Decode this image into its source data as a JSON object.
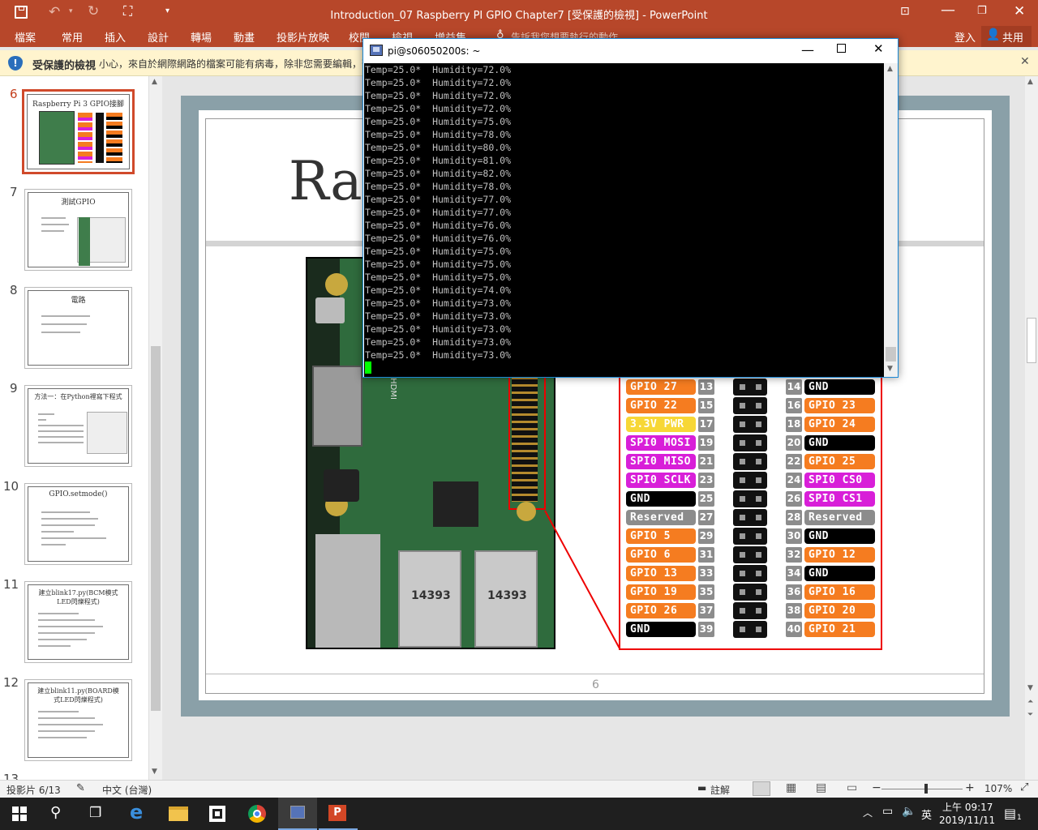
{
  "window": {
    "title": "Introduction_07 Raspberry PI GPIO Chapter7 [受保護的檢視] - PowerPoint"
  },
  "ribbon": {
    "tabs": [
      "檔案",
      "常用",
      "插入",
      "設計",
      "轉場",
      "動畫",
      "投影片放映",
      "校閱",
      "檢視",
      "增益集"
    ],
    "tell_me": "告訴我您想要執行的動作",
    "signin": "登入",
    "share": "共用"
  },
  "protected": {
    "label": "受保護的檢視",
    "message": "小心，來自於網際網路的檔案可能有病毒，除非您需要編輯，否則留在受保護的檢視中較為安全。"
  },
  "thumbnails": [
    {
      "num": "6",
      "title": "Raspberry Pi 3 GPIO接腳"
    },
    {
      "num": "7",
      "title": "測試GPIO"
    },
    {
      "num": "8",
      "title": "電路"
    },
    {
      "num": "9",
      "title": "方法一：在Python裡寫下程式"
    },
    {
      "num": "10",
      "title": "GPIO.setmode()"
    },
    {
      "num": "11",
      "title": "建立blink17.py(BCM模式LED閃爍程式)"
    },
    {
      "num": "12",
      "title": "建立blink11.py(BOARD模式LED閃爍程式)"
    },
    {
      "num": "13",
      "title": ""
    }
  ],
  "slide": {
    "title_partial": "Ras",
    "page_number": "6"
  },
  "pinout": {
    "left": [
      {
        "label": "GPIO 27",
        "num": "13",
        "color": "#f57c20"
      },
      {
        "label": "GPIO 22",
        "num": "15",
        "color": "#f57c20"
      },
      {
        "label": "3.3V PWR",
        "num": "17",
        "color": "#f7d736"
      },
      {
        "label": "SPI0 MOSI",
        "num": "19",
        "color": "#d81fd8"
      },
      {
        "label": "SPI0 MISO",
        "num": "21",
        "color": "#d81fd8"
      },
      {
        "label": "SPI0 SCLK",
        "num": "23",
        "color": "#d81fd8"
      },
      {
        "label": "GND",
        "num": "25",
        "color": "#000000"
      },
      {
        "label": "Reserved",
        "num": "27",
        "color": "#8c8c8c"
      },
      {
        "label": "GPIO 5",
        "num": "29",
        "color": "#f57c20"
      },
      {
        "label": "GPIO 6",
        "num": "31",
        "color": "#f57c20"
      },
      {
        "label": "GPIO 13",
        "num": "33",
        "color": "#f57c20"
      },
      {
        "label": "GPIO 19",
        "num": "35",
        "color": "#f57c20"
      },
      {
        "label": "GPIO 26",
        "num": "37",
        "color": "#f57c20"
      },
      {
        "label": "GND",
        "num": "39",
        "color": "#000000"
      }
    ],
    "right": [
      {
        "label": "GND",
        "num": "14",
        "color": "#000000"
      },
      {
        "label": "GPIO 23",
        "num": "16",
        "color": "#f57c20"
      },
      {
        "label": "GPIO 24",
        "num": "18",
        "color": "#f57c20"
      },
      {
        "label": "GND",
        "num": "20",
        "color": "#000000"
      },
      {
        "label": "GPIO 25",
        "num": "22",
        "color": "#f57c20"
      },
      {
        "label": "SPI0 CS0",
        "num": "24",
        "color": "#d81fd8"
      },
      {
        "label": "SPI0 CS1",
        "num": "26",
        "color": "#d81fd8"
      },
      {
        "label": "Reserved",
        "num": "28",
        "color": "#8c8c8c"
      },
      {
        "label": "GND",
        "num": "30",
        "color": "#000000"
      },
      {
        "label": "GPIO 12",
        "num": "32",
        "color": "#f57c20"
      },
      {
        "label": "GND",
        "num": "34",
        "color": "#000000"
      },
      {
        "label": "GPIO 16",
        "num": "36",
        "color": "#f57c20"
      },
      {
        "label": "GPIO 20",
        "num": "38",
        "color": "#f57c20"
      },
      {
        "label": "GPIO 21",
        "num": "40",
        "color": "#f57c20"
      }
    ]
  },
  "board": {
    "chip1": "14393",
    "chip2": "14393",
    "hdmi": "HDMI"
  },
  "putty": {
    "title": "pi@s06050200s: ~",
    "lines": [
      "Temp=25.0*  Humidity=72.0%",
      "Temp=25.0*  Humidity=72.0%",
      "Temp=25.0*  Humidity=72.0%",
      "Temp=25.0*  Humidity=72.0%",
      "Temp=25.0*  Humidity=75.0%",
      "Temp=25.0*  Humidity=78.0%",
      "Temp=25.0*  Humidity=80.0%",
      "Temp=25.0*  Humidity=81.0%",
      "Temp=25.0*  Humidity=82.0%",
      "Temp=25.0*  Humidity=78.0%",
      "Temp=25.0*  Humidity=77.0%",
      "Temp=25.0*  Humidity=77.0%",
      "Temp=25.0*  Humidity=76.0%",
      "Temp=25.0*  Humidity=76.0%",
      "Temp=25.0*  Humidity=75.0%",
      "Temp=25.0*  Humidity=75.0%",
      "Temp=25.0*  Humidity=75.0%",
      "Temp=25.0*  Humidity=74.0%",
      "Temp=25.0*  Humidity=73.0%",
      "Temp=25.0*  Humidity=73.0%",
      "Temp=25.0*  Humidity=73.0%",
      "Temp=25.0*  Humidity=73.0%",
      "Temp=25.0*  Humidity=73.0%"
    ]
  },
  "status": {
    "slide": "投影片 6/13",
    "lang": "中文 (台灣)",
    "notes": "註解",
    "zoom": "107%",
    "zoom_level": 0.55
  },
  "taskbar": {
    "time": "上午 09:17",
    "date": "2019/11/11",
    "ime": "英",
    "notif": "1"
  },
  "colors": {
    "accent": "#b7472a",
    "putty_border": "#1b88d6",
    "cursor": "#00ff00"
  }
}
